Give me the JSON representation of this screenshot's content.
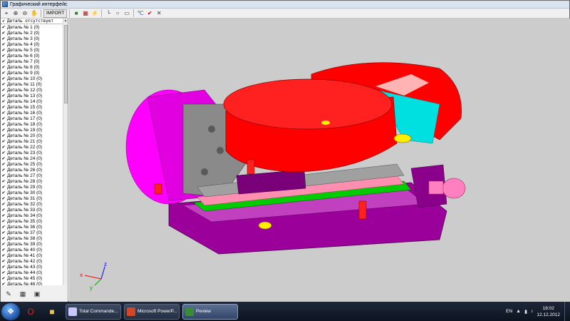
{
  "window": {
    "title": "Графический интерфейс",
    "app_icon": "app-window-icon"
  },
  "toolbar": {
    "buttons": [
      {
        "name": "zoom-region-icon",
        "glyph": "⌖"
      },
      {
        "name": "zoom-in-icon",
        "glyph": "⊕"
      },
      {
        "name": "zoom-out-icon",
        "glyph": "⊖"
      },
      {
        "name": "pan-icon",
        "glyph": "✋"
      }
    ],
    "import_label": "IMPORT",
    "buttons2": [
      {
        "name": "shaded-view-icon",
        "glyph": "■"
      },
      {
        "name": "grid-icon",
        "glyph": "▦"
      },
      {
        "name": "flash-icon",
        "glyph": "⚡"
      }
    ],
    "buttons3": [
      {
        "name": "axis-icon",
        "glyph": "└"
      },
      {
        "name": "circle-icon",
        "glyph": "○"
      },
      {
        "name": "rectangle-icon",
        "glyph": "▭"
      }
    ],
    "buttons4": [
      {
        "name": "temperature-icon",
        "glyph": "℃"
      },
      {
        "name": "accept-icon",
        "glyph": "✔"
      },
      {
        "name": "close-icon",
        "glyph": "✕"
      }
    ],
    "colors": {
      "accept": "#c00000",
      "temperature": "#1a5fb4",
      "grid": "#b02020",
      "shaded": "#2f7d2f",
      "flash": "#c9a300"
    }
  },
  "tree": {
    "header": "Деталь отсутствует",
    "items": [
      "Деталь № 1 (0)",
      "Деталь № 2 (0)",
      "Деталь № 3 (0)",
      "Деталь № 4 (0)",
      "Деталь № 5 (0)",
      "Деталь № 6 (0)",
      "Деталь № 7 (0)",
      "Деталь № 8 (0)",
      "Деталь № 9 (0)",
      "Деталь № 10 (0)",
      "Деталь № 11 (0)",
      "Деталь № 12 (0)",
      "Деталь № 13 (0)",
      "Деталь № 14 (0)",
      "Деталь № 15 (0)",
      "Деталь № 16 (0)",
      "Деталь № 17 (0)",
      "Деталь № 18 (0)",
      "Деталь № 19 (0)",
      "Деталь № 20 (0)",
      "Деталь № 21 (0)",
      "Деталь № 22 (0)",
      "Деталь № 23 (0)",
      "Деталь № 24 (0)",
      "Деталь № 25 (0)",
      "Деталь № 26 (0)",
      "Деталь № 27 (0)",
      "Деталь № 28 (0)",
      "Деталь № 29 (0)",
      "Деталь № 30 (0)",
      "Деталь № 31 (0)",
      "Деталь № 32 (0)",
      "Деталь № 33 (0)",
      "Деталь № 34 (0)",
      "Деталь № 35 (0)",
      "Деталь № 36 (0)",
      "Деталь № 37 (0)",
      "Деталь № 38 (0)",
      "Деталь № 39 (0)",
      "Деталь № 40 (0)",
      "Деталь № 41 (0)",
      "Деталь № 42 (0)",
      "Деталь № 43 (0)",
      "Деталь № 44 (0)",
      "Деталь № 45 (0)",
      "Деталь № 46 (0)"
    ],
    "bottom_buttons": [
      {
        "name": "edit-icon",
        "glyph": "✎"
      },
      {
        "name": "table-icon",
        "glyph": "▦"
      },
      {
        "name": "photo-icon",
        "glyph": "▣"
      }
    ]
  },
  "viewport": {
    "background": "#cccccc",
    "axes": {
      "x": "x",
      "y": "y",
      "z": "z"
    },
    "colors": {
      "red": "#ff0000",
      "magenta": "#ff00ff",
      "purple": "#9b009b",
      "gray": "#8a8a8a",
      "cyan": "#00e0e0",
      "green": "#00cc00",
      "yellow": "#ffee00",
      "pink": "#ff8fb0"
    }
  },
  "taskbar": {
    "tasks": [
      {
        "label": "Total Commande...",
        "icon_color": "#c9c9ff",
        "active": false
      },
      {
        "label": "Microsoft PowerP...",
        "icon_color": "#d24726",
        "active": false
      },
      {
        "label": "Peview",
        "icon_color": "#3a8a3a",
        "active": true
      }
    ],
    "pinned": [
      {
        "name": "opera-icon",
        "glyph": "O",
        "color": "#e0201b"
      },
      {
        "name": "explorer-folder-icon",
        "glyph": "■",
        "color": "#e8c060"
      }
    ],
    "lang": "EN",
    "time": "18:02",
    "date": "12.12.2012"
  }
}
